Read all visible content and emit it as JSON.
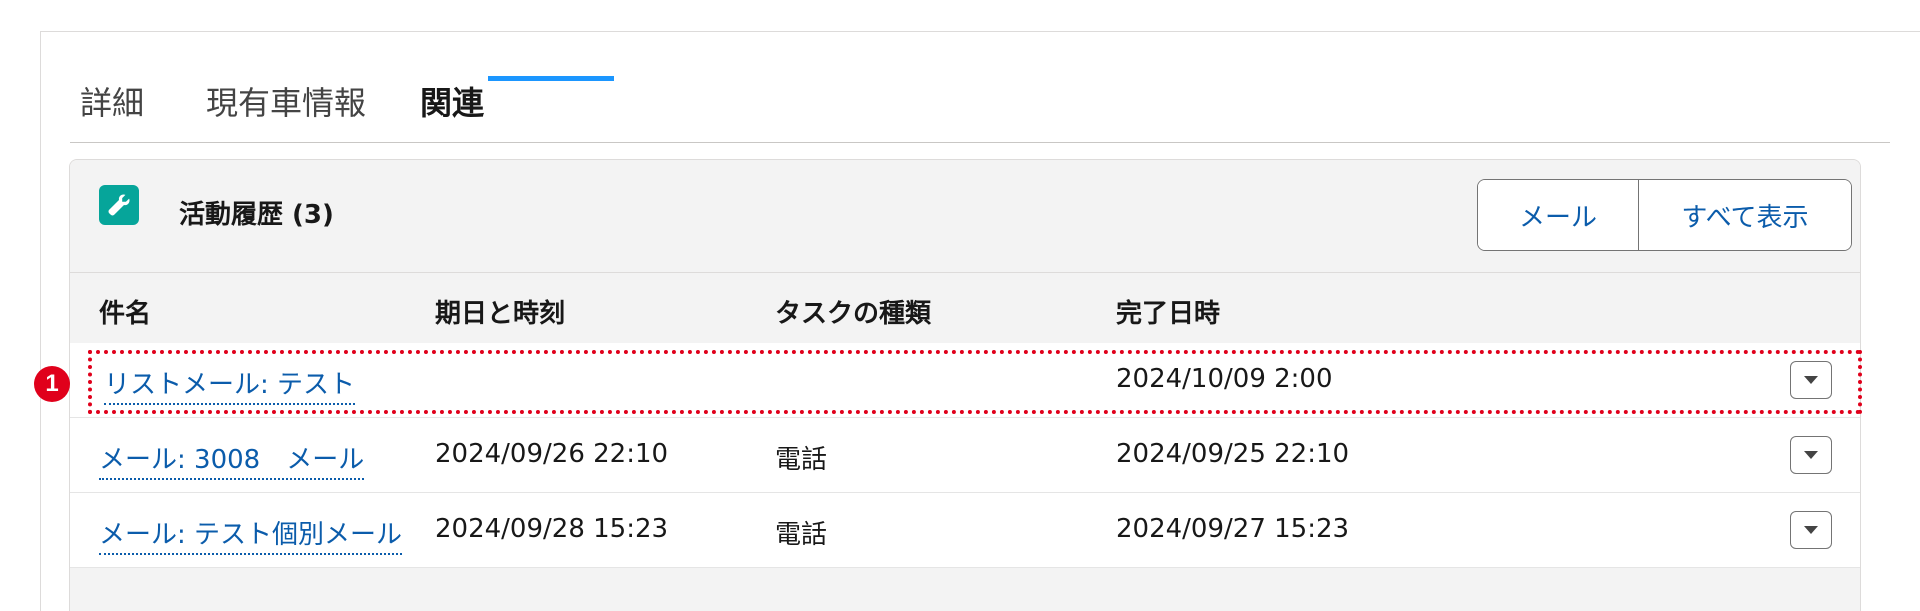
{
  "tabs": [
    {
      "label": "詳細",
      "active": false
    },
    {
      "label": "現有車情報",
      "active": false
    },
    {
      "label": "関連",
      "active": true
    }
  ],
  "card": {
    "icon": "wrench-icon",
    "title": "活動履歴 (3)",
    "buttons": {
      "mail": "メール",
      "view_all": "すべて表示"
    }
  },
  "columns": [
    "件名",
    "期日と時刻",
    "タスクの種類",
    "完了日時"
  ],
  "rows": [
    {
      "subject": "リストメール: テスト",
      "due": "",
      "task_type": "",
      "completed": "2024/10/09 2:00"
    },
    {
      "subject": "メール: 3008　メール",
      "due": "2024/09/26 22:10",
      "task_type": "電話",
      "completed": "2024/09/25 22:10"
    },
    {
      "subject": "メール: テスト個別メール",
      "due": "2024/09/28 15:23",
      "task_type": "電話",
      "completed": "2024/09/27 15:23"
    }
  ],
  "annotation": {
    "marker": "1",
    "color": "#e0001b"
  },
  "colors": {
    "accent": "#1b96ff",
    "link": "#0b5cab",
    "icon_bg": "#06a59a"
  }
}
